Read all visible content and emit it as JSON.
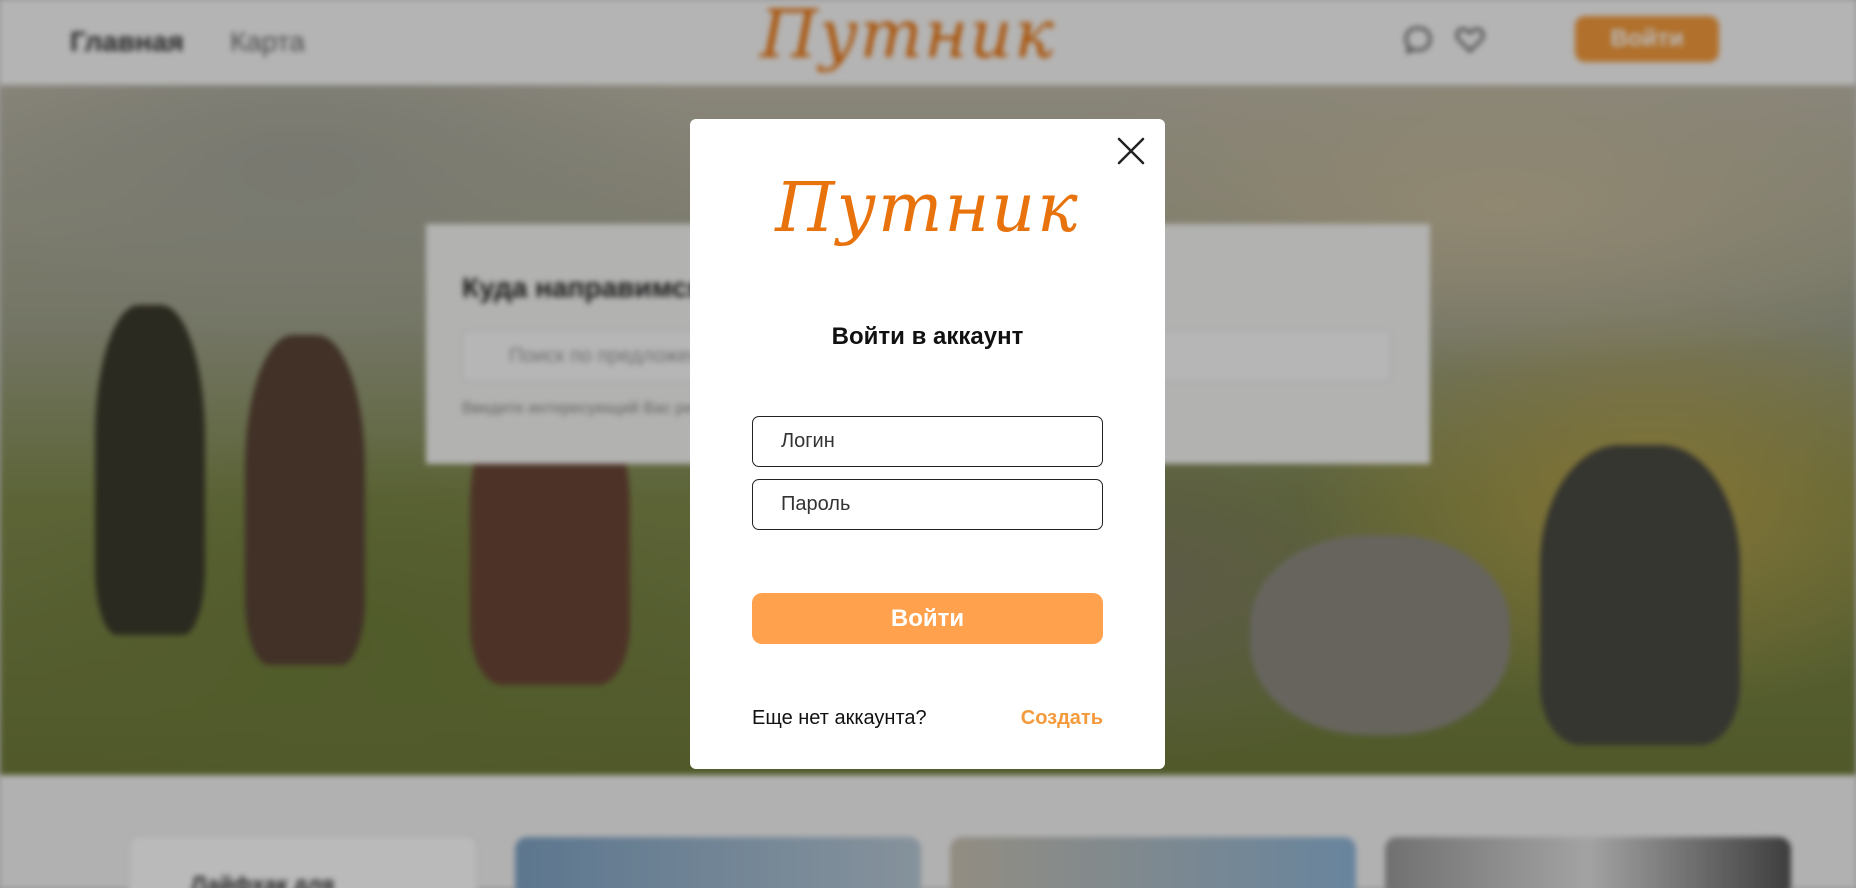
{
  "background": {
    "nav": {
      "home": "Главная",
      "map": "Карта"
    },
    "logo": "Путник",
    "login_button": "Войти",
    "search": {
      "title": "Куда направимся?",
      "placeholder": "Поиск по предложениям",
      "hint": "Введите интересующий Вас регион"
    },
    "side_card_title": "Лайфхак для путешествий"
  },
  "modal": {
    "logo": "Путник",
    "title": "Войти в аккаунт",
    "login_placeholder": "Логин",
    "password_placeholder": "Пароль",
    "submit_label": "Войти",
    "no_account_text": "Еще нет аккаунта?",
    "create_link": "Создать"
  },
  "colors": {
    "brand_orange": "#e8720c",
    "button_orange": "#ffa14d",
    "link_orange": "#f39a3c"
  },
  "icons": [
    "chat-icon",
    "heart-icon",
    "close-icon"
  ]
}
